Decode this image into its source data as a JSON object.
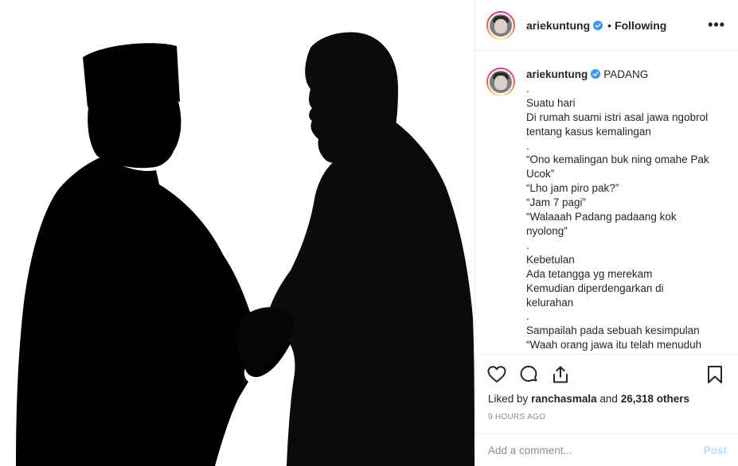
{
  "post": {
    "image": {
      "description_icon": "silhouette-handshake-image"
    },
    "author": {
      "username": "ariekuntung",
      "verified": true,
      "follow_status": "Following",
      "separator": "•"
    },
    "more_label": "•••",
    "caption": {
      "username": "ariekuntung",
      "location": "PADANG",
      "lines": [
        ".",
        "Suatu hari",
        "Di rumah suami istri asal jawa ngobrol",
        "tentang kasus kemalingan",
        ".",
        "“Ono kemalingan buk ning omahe Pak",
        "Ucok”",
        "“Lho jam piro pak?”",
        "“Jam 7 pagi”",
        "“Walaaah Padang padaang kok",
        "nyolong”",
        ".",
        "Kebetulan",
        "Ada tetangga yg merekam",
        "Kemudian diperdengarkan di",
        "kelurahan",
        ".",
        "Sampailah pada sebuah kesimpulan",
        "“Waah orang jawa itu telah menuduh"
      ]
    },
    "actions": {
      "like_icon": "heart-icon",
      "comment_icon": "comment-icon",
      "share_icon": "share-icon",
      "save_icon": "bookmark-icon"
    },
    "likes": {
      "prefix": "Liked by",
      "user": "ranchasmala",
      "middle": "and",
      "others": "26,318 others"
    },
    "timestamp": "9 HOURS AGO",
    "comment_box": {
      "placeholder": "Add a comment...",
      "post_label": "Post"
    }
  },
  "colors": {
    "verified_blue": "#3897f0",
    "post_disabled": "#b2dffc",
    "muted": "#8e8e8e"
  }
}
